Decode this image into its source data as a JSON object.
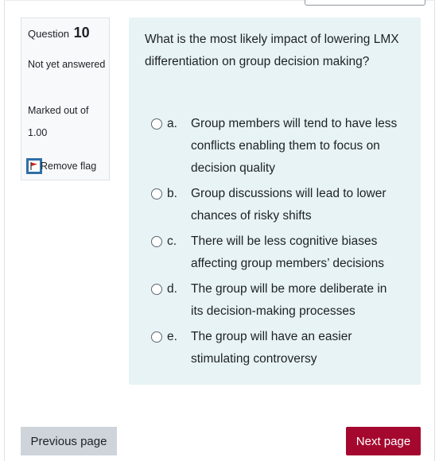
{
  "question_info": {
    "label": "Question",
    "number": "10",
    "state": "Not yet answered",
    "grade": "Marked out of 1.00",
    "flag_label": "Remove flag"
  },
  "question": {
    "text": "What is the most likely impact of lowering LMX differentiation on group decision making?",
    "answers": [
      {
        "letter": "a.",
        "text": "Group members will tend to have less conflicts enabling them to focus on decision quality"
      },
      {
        "letter": "b.",
        "text": "Group discussions will lead to lower chances of risky shifts"
      },
      {
        "letter": "c.",
        "text": "There will be less cognitive biases affecting group members’ decisions"
      },
      {
        "letter": "d.",
        "text": "The group will be more deliberate in its decision-making processes"
      },
      {
        "letter": "e.",
        "text": "The group will have an easier stimulating controversy"
      }
    ]
  },
  "navigation": {
    "previous_label": "Previous page",
    "next_label": "Next page"
  },
  "colors": {
    "accent": "#a4082f",
    "formulation_bg": "#e7f3f5",
    "flag_red": "#d62020"
  }
}
